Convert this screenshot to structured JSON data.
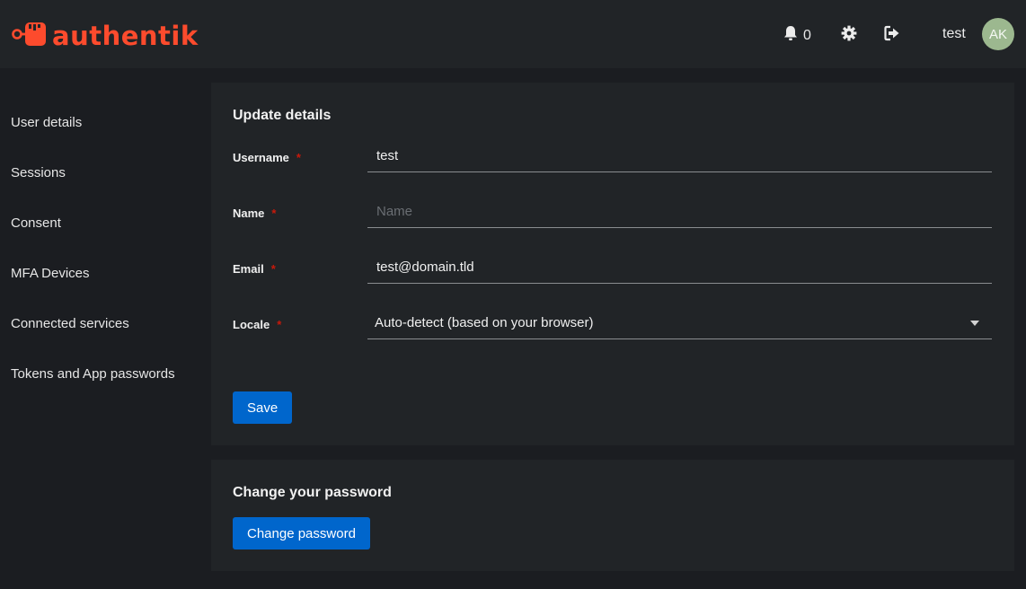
{
  "header": {
    "brand": "authentik",
    "notification_count": "0",
    "username": "test",
    "avatar_initials": "AK"
  },
  "sidebar": {
    "items": [
      {
        "label": "User details"
      },
      {
        "label": "Sessions"
      },
      {
        "label": "Consent"
      },
      {
        "label": "MFA Devices"
      },
      {
        "label": "Connected services"
      },
      {
        "label": "Tokens and App passwords"
      }
    ]
  },
  "update_details": {
    "title": "Update details",
    "username": {
      "label": "Username",
      "value": "test"
    },
    "name": {
      "label": "Name",
      "placeholder": "Name"
    },
    "email": {
      "label": "Email",
      "value": "test@domain.tld"
    },
    "locale": {
      "label": "Locale",
      "value": "Auto-detect (based on your browser)"
    },
    "required_mark": "*",
    "save_label": "Save"
  },
  "change_password": {
    "title": "Change your password",
    "button_label": "Change password"
  },
  "colors": {
    "brand": "#fd4b2d",
    "primary_button": "#0066cc",
    "avatar": "#9cb88f"
  },
  "icons": [
    "authentik-logo-icon",
    "bell-icon",
    "gear-icon",
    "sign-out-icon",
    "caret-down-icon"
  ]
}
